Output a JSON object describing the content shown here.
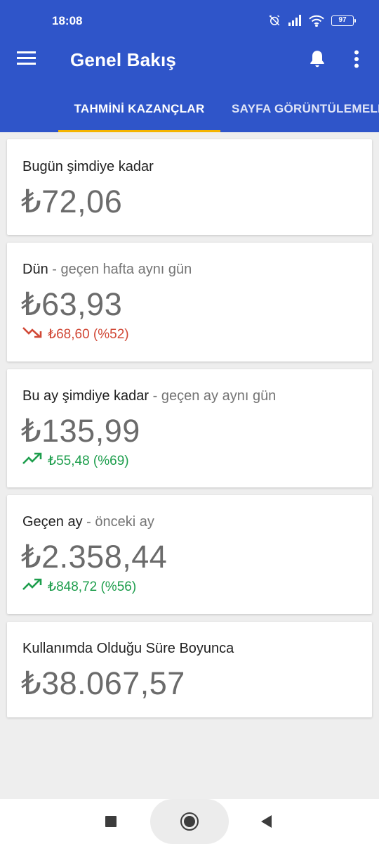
{
  "status_bar": {
    "time": "18:08",
    "battery": "97"
  },
  "app_bar": {
    "title": "Genel Bakış"
  },
  "tabs": [
    {
      "label": "TAHMİNİ KAZANÇLAR",
      "active": true
    },
    {
      "label": "SAYFA GÖRÜNTÜLEMELER",
      "active": false
    }
  ],
  "cards": [
    {
      "label": "Bugün şimdiye kadar",
      "sublabel": "",
      "value": "₺72,06"
    },
    {
      "label": "Dün",
      "sublabel": " - geçen hafta aynı gün",
      "value": "₺63,93",
      "change": "₺68,60 (%52)",
      "trend": "down"
    },
    {
      "label": "Bu ay şimdiye kadar",
      "sublabel": " - geçen ay aynı gün",
      "value": "₺135,99",
      "change": "₺55,48 (%69)",
      "trend": "up"
    },
    {
      "label": "Geçen ay",
      "sublabel": " - önceki ay",
      "value": "₺2.358,44",
      "change": "₺848,72 (%56)",
      "trend": "up"
    },
    {
      "label": "Kullanımda Olduğu Süre Boyunca",
      "sublabel": "",
      "value": "₺38.067,57"
    }
  ],
  "colors": {
    "primary": "#2f55c9",
    "tab_indicator": "#f4b400",
    "down": "#d14836",
    "up": "#1e9e4d"
  }
}
